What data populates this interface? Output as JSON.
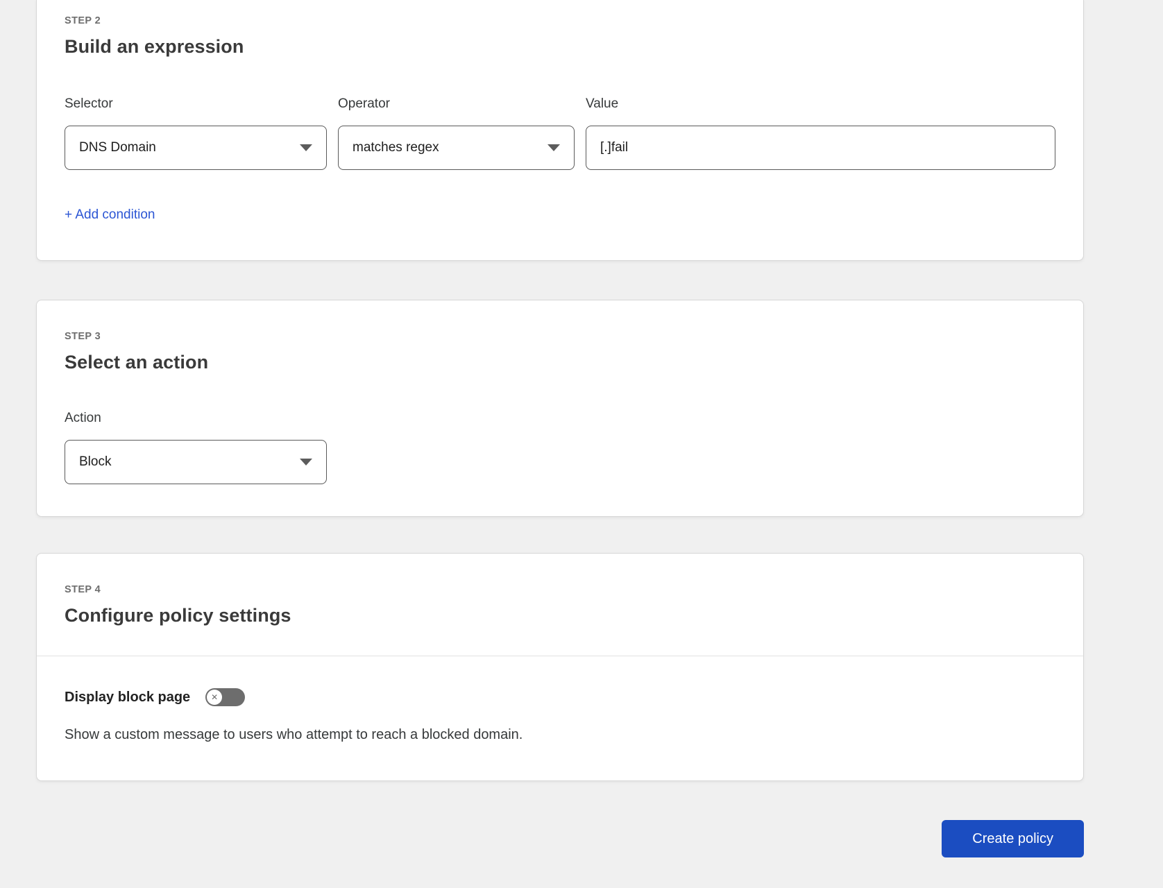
{
  "steps": {
    "step2": {
      "eyebrow": "STEP 2",
      "title": "Build an expression",
      "fields": [
        {
          "label": "Selector",
          "value": "DNS Domain"
        },
        {
          "label": "Operator",
          "value": "matches regex"
        },
        {
          "label": "Value",
          "value": "[.]fail"
        }
      ],
      "add_condition_label": "+ Add condition"
    },
    "step3": {
      "eyebrow": "STEP 3",
      "title": "Select an action",
      "action_label": "Action",
      "action_value": "Block"
    },
    "step4": {
      "eyebrow": "STEP 4",
      "title": "Configure policy settings",
      "block_page_setting": {
        "label": "Display block page",
        "toggle_state": "off",
        "toggle_icon": "✕",
        "description": "Show a custom message to users who attempt to reach a blocked domain."
      }
    }
  },
  "footer": {
    "create_button_label": "Create policy"
  },
  "colors": {
    "accent-blue": "#1b4dc1",
    "link-blue": "#2b55d4",
    "toggle-gray": "#6d6d6d",
    "page-bg": "#f0f0f0"
  }
}
